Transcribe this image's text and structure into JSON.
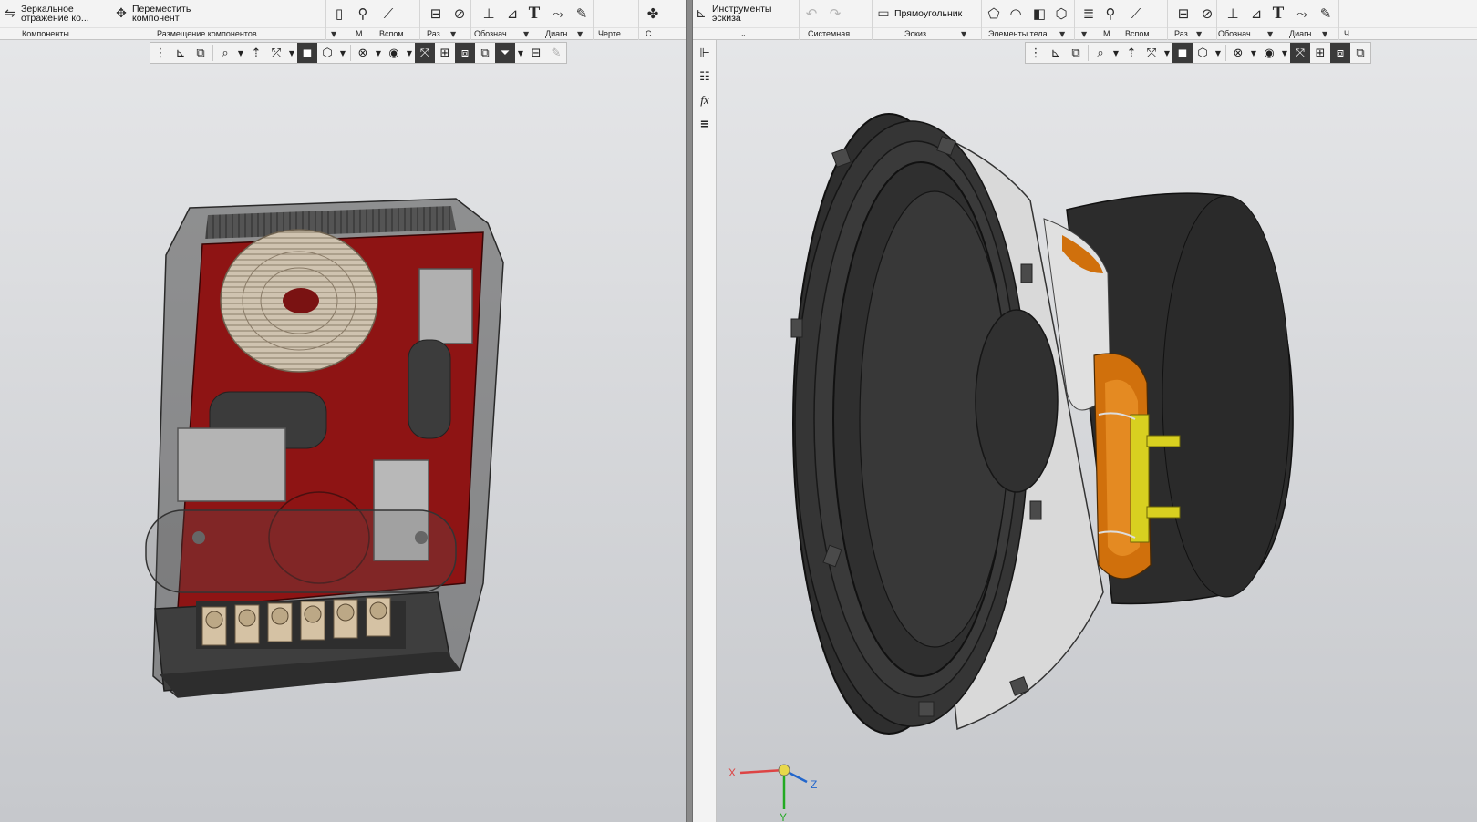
{
  "left_ribbon": {
    "mirror_label": "Зеркальное\nотражение ко...",
    "move_label": "Переместить\nкомпонент",
    "groups": {
      "components": "Компоненты",
      "placement": "Размещение компонентов",
      "m": "М...",
      "aux": "Вспом...",
      "cuts": "Раз...",
      "designations": "Обознач...",
      "diagrams": "Диагн...",
      "drawing": "Черте...",
      "c": "С..."
    }
  },
  "right_ribbon": {
    "sketch_tools_label": "Инструменты\nэскиза",
    "rectangle_label": "Прямоугольник",
    "groups": {
      "system": "Системная",
      "sketch": "Эскиз",
      "body_elements": "Элементы тела",
      "m": "М...",
      "aux": "Вспом...",
      "cuts": "Раз...",
      "designations": "Обознач...",
      "diagrams": "Диагн...",
      "ch": "Ч..."
    }
  },
  "axis_labels": {
    "x": "X",
    "y": "Y",
    "z": "Z"
  },
  "colors": {
    "pcb": "#8e1414",
    "coil": "#d2c6b4",
    "case": "#3c3c3c",
    "speaker_rubber": "#2d2d2d",
    "basket": "#d9d9d9",
    "voice_coil": "#d0700c",
    "terminal": "#d8d020"
  }
}
